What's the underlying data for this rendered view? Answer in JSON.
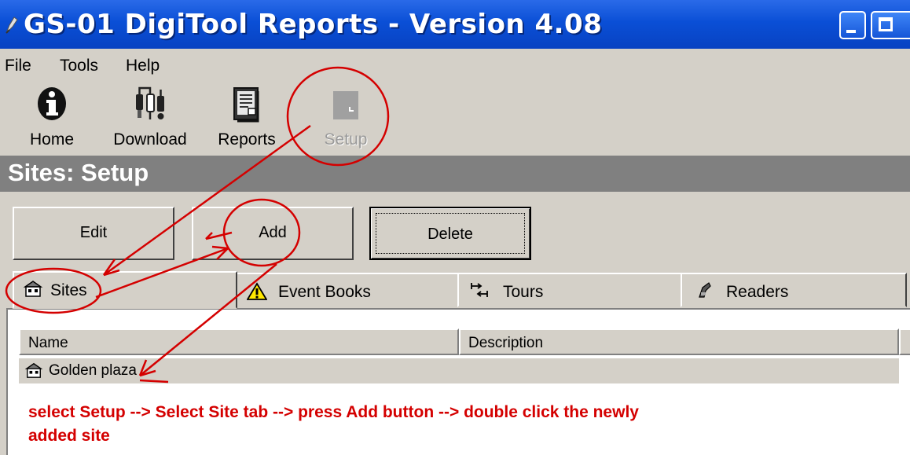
{
  "window": {
    "title": "GS-01 DigiTool Reports - Version 4.08",
    "app_icon": "pen-app-icon"
  },
  "menu": {
    "items": [
      {
        "label": "File"
      },
      {
        "label": "Tools"
      },
      {
        "label": "Help"
      }
    ]
  },
  "toolbar": {
    "home_label": "Home",
    "download_label": "Download",
    "reports_label": "Reports",
    "setup_label": "Setup"
  },
  "section": {
    "title": "Sites: Setup"
  },
  "actions": {
    "edit_label": "Edit",
    "add_label": "Add",
    "delete_label": "Delete"
  },
  "tabs": [
    {
      "label": "Sites",
      "icon": "building-icon"
    },
    {
      "label": "Event Books",
      "icon": "warning-icon"
    },
    {
      "label": "Tours",
      "icon": "tours-icon"
    },
    {
      "label": "Readers",
      "icon": "reader-icon"
    }
  ],
  "table": {
    "columns": [
      "Name",
      "Description"
    ],
    "rows": [
      {
        "name": "Golden plaza",
        "description": ""
      }
    ]
  },
  "annotation": {
    "line1": "select Setup --> Select Site tab --> press Add button --> double click the newly",
    "line2": "added site",
    "color": "#d40000"
  }
}
